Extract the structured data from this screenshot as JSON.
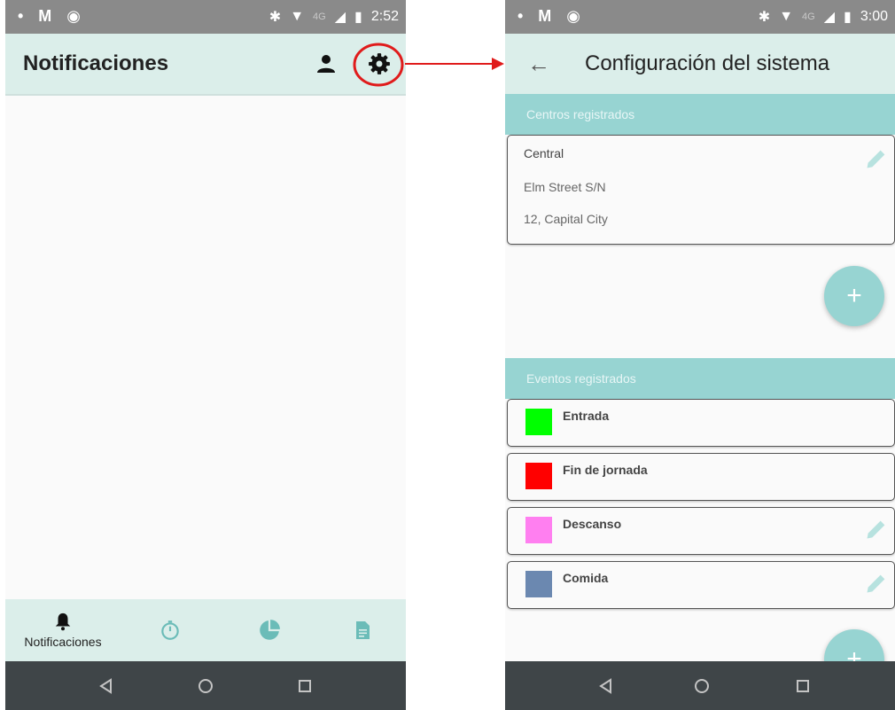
{
  "left_screen": {
    "status": {
      "left_icons": "• M ◉",
      "time": "2:52",
      "network": "4G"
    },
    "app_bar": {
      "title": "Notificaciones"
    },
    "bottom_nav": {
      "notifications_label": "Notificaciones"
    }
  },
  "right_screen": {
    "status": {
      "left_icons": "• M ◉",
      "time": "3:00",
      "network": "4G"
    },
    "app_bar": {
      "title": "Configuración del sistema"
    },
    "centers": {
      "header": "Centros registrados",
      "items": [
        {
          "name": "Central",
          "line1": "Elm Street S/N",
          "line2": "12, Capital City"
        }
      ],
      "add_label": "+"
    },
    "events": {
      "header": "Eventos registrados",
      "items": [
        {
          "label": "Entrada",
          "color": "#00ff00"
        },
        {
          "label": "Fin de jornada",
          "color": "#ff0000"
        },
        {
          "label": "Descanso",
          "color": "#ff7ff0"
        },
        {
          "label": "Comida",
          "color": "#6b88b0"
        }
      ],
      "add_label": "+"
    }
  },
  "colors": {
    "app_bar_bg": "#dbeeea",
    "section_header_bg": "#97d4d2",
    "highlight_circle": "#e01b1b",
    "system_nav_bg": "#3f4548"
  },
  "icons": {
    "left_app_bar": [
      "person-icon",
      "gear-icon"
    ],
    "right_app_bar": [
      "back-arrow-icon"
    ],
    "card_action": "pencil-icon",
    "bottom_nav": [
      "bell-icon",
      "timer-icon",
      "pie-chart-icon",
      "document-icon"
    ],
    "system_nav": [
      "back-triangle-icon",
      "home-circle-icon",
      "recents-square-icon"
    ]
  }
}
